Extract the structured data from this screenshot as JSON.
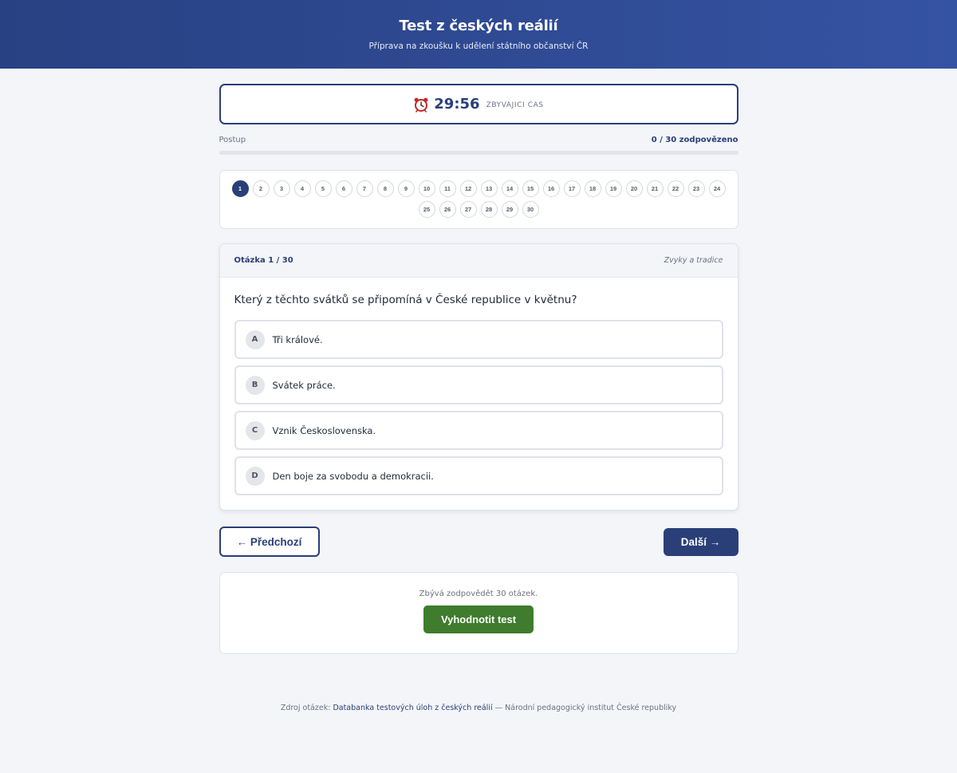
{
  "header": {
    "title": "Test z českých reálií",
    "subtitle": "Příprava na zkoušku k udělení státního občanství ČR"
  },
  "timer": {
    "icon": "alarm-clock-icon",
    "time": "29:56",
    "label": "ZBYVAJICI CAS"
  },
  "progress": {
    "label": "Postup",
    "count_text": "0 / 30 zodpovězeno",
    "answered": 0,
    "total": 30
  },
  "question_nav": {
    "active": 1,
    "items": [
      "1",
      "2",
      "3",
      "4",
      "5",
      "6",
      "7",
      "8",
      "9",
      "10",
      "11",
      "12",
      "13",
      "14",
      "15",
      "16",
      "17",
      "18",
      "19",
      "20",
      "21",
      "22",
      "23",
      "24",
      "25",
      "26",
      "27",
      "28",
      "29",
      "30"
    ]
  },
  "question": {
    "number_label": "Otázka 1 / 30",
    "category": "Zvyky a tradice",
    "text": "Který z těchto svátků se připomíná v České republice v květnu?",
    "answers": [
      {
        "letter": "A",
        "text": "Tři králové."
      },
      {
        "letter": "B",
        "text": "Svátek práce."
      },
      {
        "letter": "C",
        "text": "Vznik Československa."
      },
      {
        "letter": "D",
        "text": "Den boje za svobodu a demokracii."
      }
    ]
  },
  "navigation": {
    "prev_label": "← Předchozí",
    "next_label": "Další →"
  },
  "submit": {
    "remaining_text": "Zbývá zodpovědět 30 otázek.",
    "button_label": "Vyhodnotit test"
  },
  "footer": {
    "prefix": "Zdroj otázek: ",
    "link_text": "Databanka testových úloh z českých reálií",
    "suffix": " — Národní pedagogický institut České republiky"
  }
}
